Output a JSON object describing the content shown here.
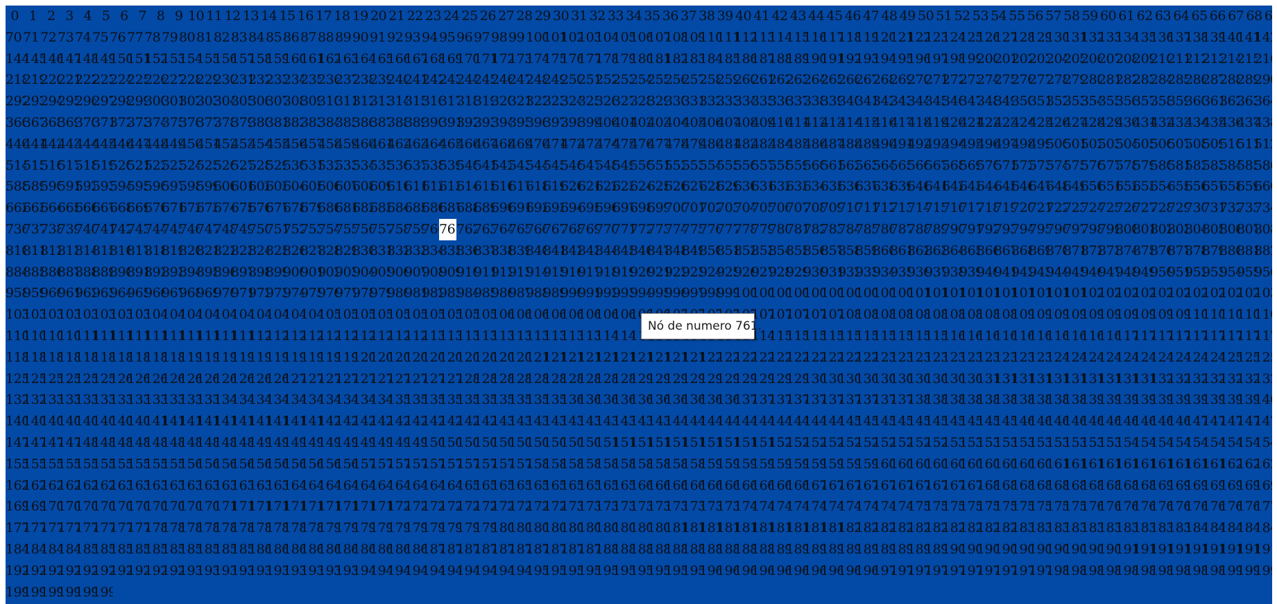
{
  "grid": {
    "node_count": 2000,
    "highlighted_node": 761,
    "highlighted_label": "76",
    "background_color": "#0349a6",
    "text_color": "#0a1118",
    "highlight_color": "#ffffff"
  },
  "tooltip": {
    "text": "Nó de numero 761."
  }
}
